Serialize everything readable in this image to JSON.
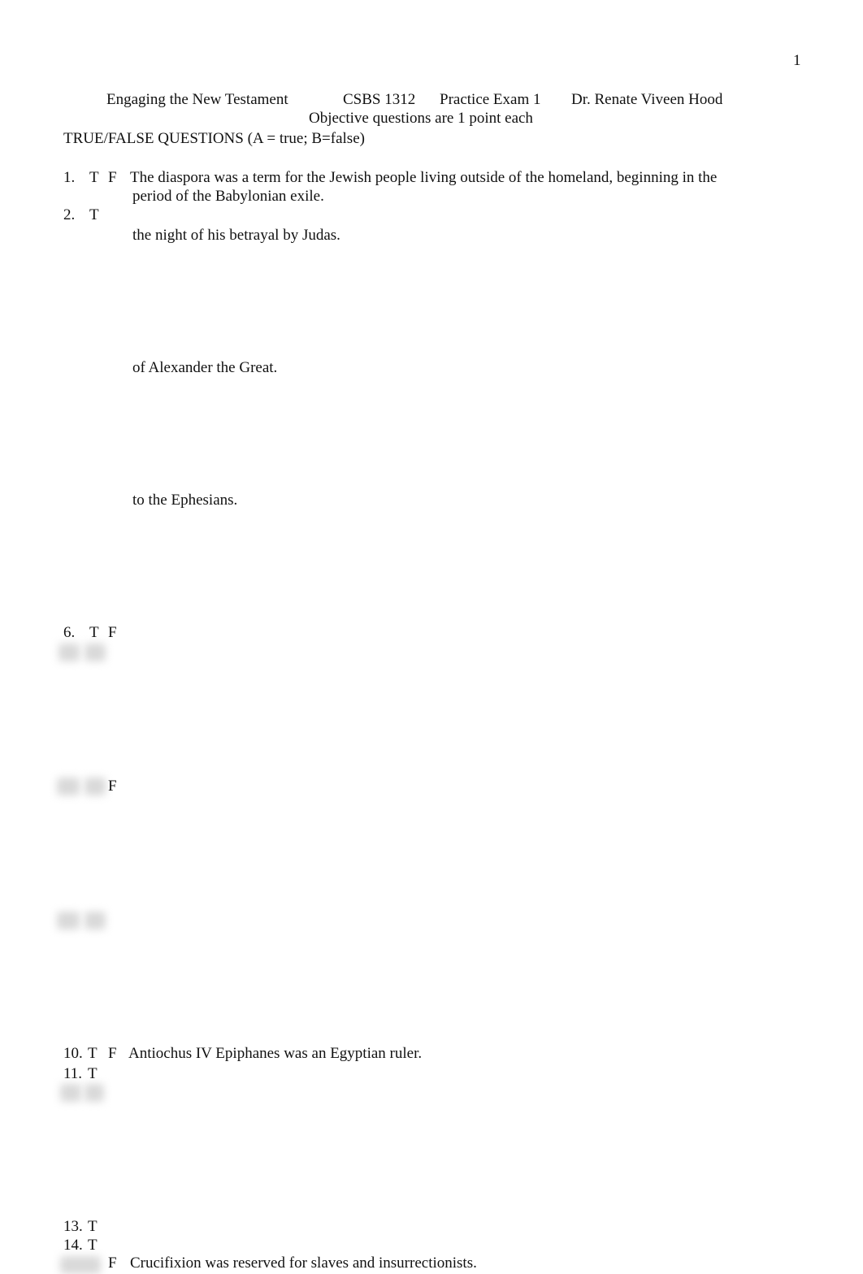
{
  "page_number": "1",
  "header": {
    "course_title": "Engaging the New Testament",
    "course_code": "CSBS 1312",
    "exam_name": "Practice Exam 1",
    "instructor": "Dr. Renate Viveen Hood",
    "subtitle": "Objective questions are 1 point each"
  },
  "section_title": "TRUE/FALSE QUESTIONS (A = true; B=false)",
  "questions": [
    {
      "number": "1.",
      "t": "T",
      "f": "F",
      "text": "The diaspora was a term for the Jewish people living outside of the homeland, beginning in the",
      "continuation": "period of the Babylonian exile."
    },
    {
      "number": "2.",
      "t": "T",
      "continuation": "the night of his betrayal by Judas."
    },
    {
      "continuation": "of Alexander the Great."
    },
    {
      "continuation": "to the Ephesians."
    },
    {
      "number": "6.",
      "t": "T",
      "f": "F"
    },
    {
      "f": "F"
    },
    {
      "number": "10.",
      "t": "T",
      "f": "F",
      "text": "Antiochus IV Epiphanes was an Egyptian ruler."
    },
    {
      "number": "11.",
      "t": "T"
    },
    {
      "number": "13.",
      "t": "T"
    },
    {
      "number": "14.",
      "t": "T"
    },
    {
      "f": "F",
      "text": "Crucifixion was reserved for slaves and insurrectionists."
    }
  ]
}
